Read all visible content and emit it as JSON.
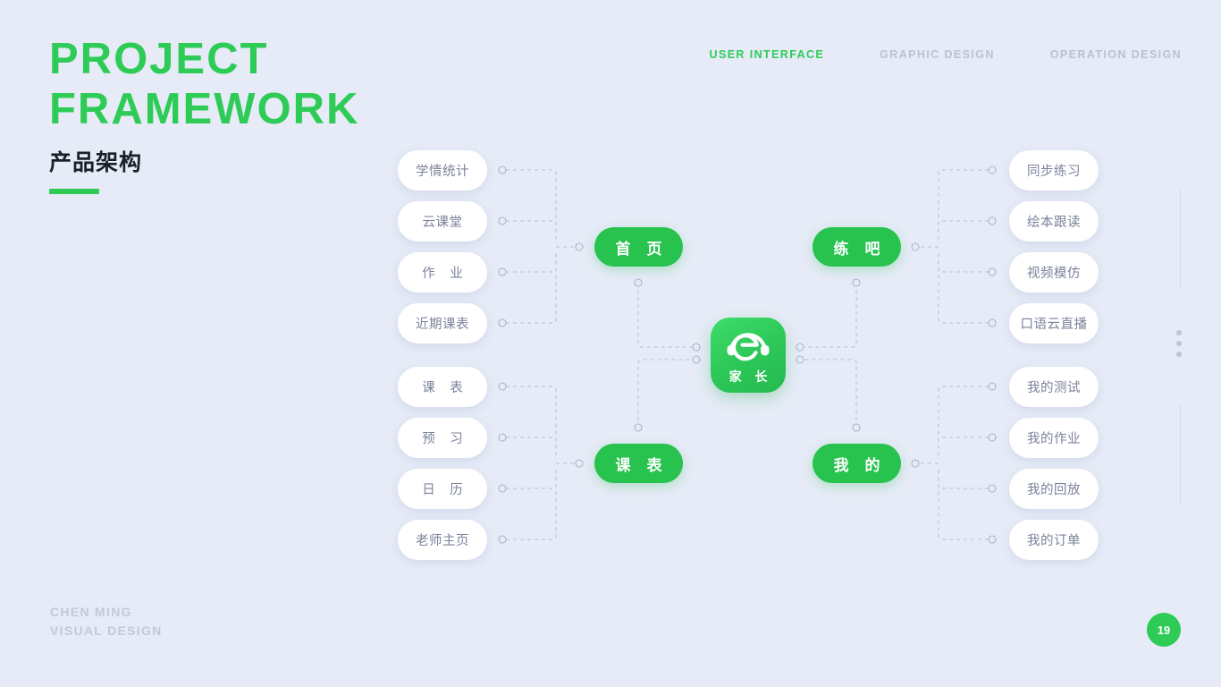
{
  "page": {
    "background_color": "#e6ebf7",
    "accent_color": "#2ecc57",
    "muted_text_color": "#7c839a",
    "page_number": "19"
  },
  "header": {
    "title_line1": "PROJECT",
    "title_line2": "FRAMEWORK",
    "subtitle": "产品架构"
  },
  "topnav": {
    "items": [
      {
        "label": "USER INTERFACE",
        "active": true
      },
      {
        "label": "GRAPHIC DESIGN",
        "active": false
      },
      {
        "label": "OPERATION DESIGN",
        "active": false
      }
    ]
  },
  "footer": {
    "credit_line1": "CHEN MING",
    "credit_line2": "VISUAL DESIGN"
  },
  "diagram": {
    "center": {
      "icon_name": "app-logo-headphone-e",
      "label": "家 长"
    },
    "branches": [
      {
        "hub_label": "首 页",
        "side": "left",
        "children": [
          "学情统计",
          "云课堂",
          "作 业",
          "近期课表"
        ]
      },
      {
        "hub_label": "课 表",
        "side": "left",
        "children": [
          "课 表",
          "预 习",
          "日 历",
          "老师主页"
        ]
      },
      {
        "hub_label": "练 吧",
        "side": "right",
        "children": [
          "同步练习",
          "绘本跟读",
          "视频模仿",
          "口语云直播"
        ]
      },
      {
        "hub_label": "我 的",
        "side": "right",
        "children": [
          "我的测试",
          "我的作业",
          "我的回放",
          "我的订单"
        ]
      }
    ]
  }
}
